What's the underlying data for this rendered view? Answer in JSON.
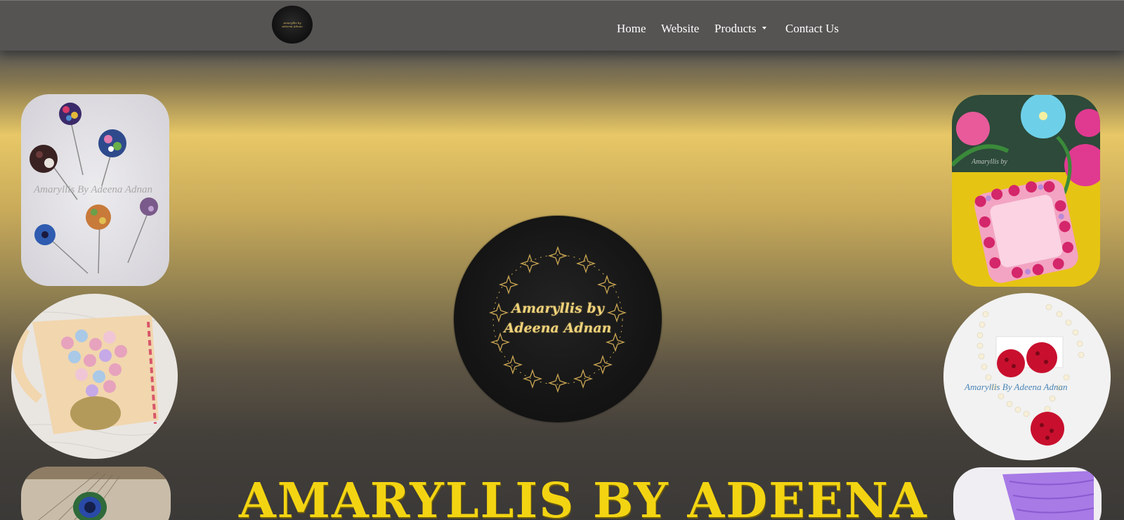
{
  "navbar": {
    "brand_logo_text": "Amaryllis by\nAdeena Adnan",
    "items": [
      {
        "label": "Home"
      },
      {
        "label": "Website"
      },
      {
        "label": "Products"
      },
      {
        "label": "Contact Us"
      }
    ]
  },
  "gallery": {
    "watermark": "Amaryllis By Adeena Adnan"
  },
  "hero": {
    "logo_text": "Amaryllis by\nAdeena Adnan",
    "title": "AMARYLLIS BY ADEENA"
  },
  "colors": {
    "navbar_bg": "#555453",
    "gold_band": "#e7c766",
    "title": "#f3d412",
    "logo_gold": "#f0d27a"
  }
}
